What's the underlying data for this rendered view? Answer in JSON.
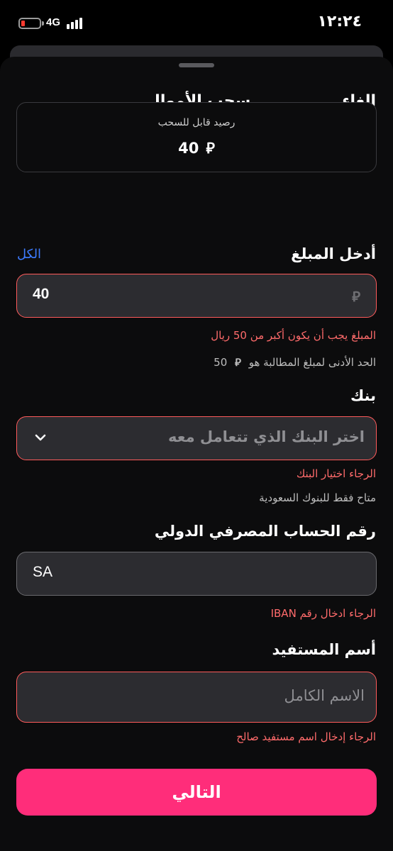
{
  "status_bar": {
    "network": "4G",
    "time": "١٢:٢٤",
    "battery_level": 0.1,
    "signal_bars": 4
  },
  "header": {
    "cancel_label": "إلغاء",
    "title": "سحب الأموال"
  },
  "balance": {
    "label": "رصيد قابل للسحب",
    "amount": "40",
    "currency_symbol": "⃁"
  },
  "amount_section": {
    "label": "أدخل المبلغ",
    "all_link": "الكل",
    "value": "40",
    "currency_symbol": "⃁",
    "error": "المبلغ يجب أن يكون أكبر من 50 ريال",
    "hint_text": "الحد الأدنى لمبلغ المطالبة هو",
    "hint_amount": "50"
  },
  "bank_section": {
    "label": "بنك",
    "placeholder": "اختر البنك الذي تتعامل معه",
    "error": "الرجاء اختيار البنك",
    "hint": "متاح فقط للبنوك السعودية"
  },
  "iban_section": {
    "label": "رقم الحساب المصرفي الدولي",
    "value": "SA",
    "error": "الرجاء ادخال رقم IBAN"
  },
  "beneficiary_section": {
    "label": "أسم المستفيد",
    "placeholder": "الاسم الكامل",
    "error": "الرجاء إدخال اسم مستفيد صالح"
  },
  "next_button_label": "التالي",
  "colors": {
    "accent": "#ff2d7a",
    "link": "#3d7cff",
    "error": "#ff6b6b",
    "field_bg": "#2c2c30",
    "sheet_bg": "#0c0c0d"
  }
}
